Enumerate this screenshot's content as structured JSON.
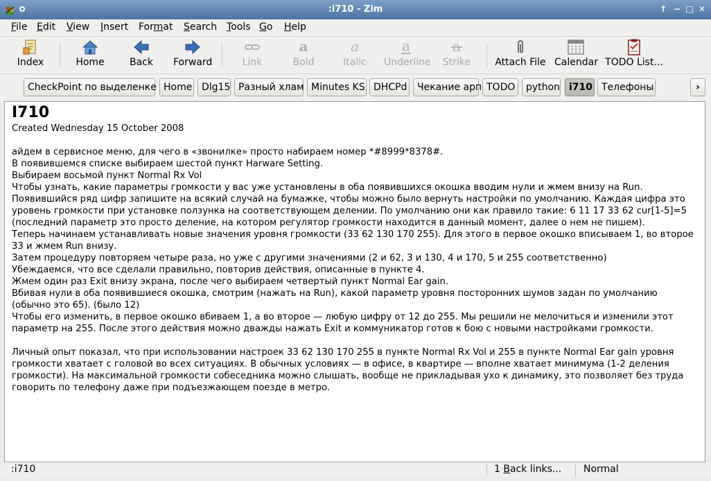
{
  "window": {
    "title": ":i710 - Zim",
    "controls": {
      "up": "↑",
      "minimize": "−",
      "maximize": "□",
      "close": "✕"
    }
  },
  "menubar": {
    "items": [
      {
        "name": "file",
        "before": "",
        "mnemonic": "F",
        "after": "ile"
      },
      {
        "name": "edit",
        "before": "",
        "mnemonic": "E",
        "after": "dit"
      },
      {
        "name": "view",
        "before": "",
        "mnemonic": "V",
        "after": "iew"
      },
      {
        "name": "insert",
        "before": "",
        "mnemonic": "I",
        "after": "nsert"
      },
      {
        "name": "format",
        "before": "For",
        "mnemonic": "m",
        "after": "at"
      },
      {
        "name": "search",
        "before": "",
        "mnemonic": "S",
        "after": "earch"
      },
      {
        "name": "tools",
        "before": "",
        "mnemonic": "T",
        "after": "ools"
      },
      {
        "name": "go",
        "before": "",
        "mnemonic": "G",
        "after": "o"
      },
      {
        "name": "help",
        "before": "",
        "mnemonic": "H",
        "after": "elp"
      }
    ]
  },
  "toolbar": {
    "index": "Index",
    "home": "Home",
    "back": "Back",
    "forward": "Forward",
    "link": "Link",
    "bold": "Bold",
    "italic": "Italic",
    "underline": "Underline",
    "strike": "Strike",
    "attach": "Attach File",
    "calendar": "Calendar",
    "todo": "TODO List..."
  },
  "pathbar": {
    "items": [
      "CheckPoint по выделенке",
      "Home",
      "Dlg15",
      "Разный хлам",
      "Minutes KS",
      "DHCPd",
      "Чекание арп",
      "TODO",
      "python",
      "i710",
      "Телефоны"
    ],
    "active": "i710",
    "scroll_arrow": "›"
  },
  "page": {
    "heading": "I710",
    "created": "Created Wednesday 15 October 2008",
    "lines": [
      "айдем в сервисное меню, для чего в «звонилке» просто набираем номер *#8999*8378#.",
      "В появившемся списке выбираем шестой пункт Harware Setting.",
      "Выбираем восьмой пункт Normal Rx Vol",
      "Чтобы узнать, какие параметры громкости у вас уже установлены в оба появившихся окошка вводим нули и жмем внизу на Run.",
      "Появившийся ряд цифр запишите на всякий случай на бумажке, чтобы можно было вернуть настройки по умолчанию. Каждая цифра это уровень громкости при установке ползунка на соответствующем делении. По умолчанию они как правило такие: 6 11 17 33 62 cur[1-5]=5 (последний параметр это просто деление, на котором регулятор громкости находится в данный момент, далее о нем не пишем).",
      "Теперь начинаем устанавливать новые значения уровня громкости (33 62 130 170 255). Для этого в первое окошко вписываем 1, во второе 33 и жмем Run внизу.",
      "Затем процедуру повторяем четыре раза, но уже с другими значениями (2 и 62, 3 и 130, 4 и 170, 5 и 255 соответственно)",
      "Убеждаемся, что все сделали правильно, повторив действия, описанные в пункте 4.",
      "Жмем один раз Exit внизу экрана, после чего выбираем четвертый пункт Normal Ear gain.",
      "Вбивая нули в оба появившиеся окошка, смотрим (нажать на Run), какой параметр уровня посторонних шумов задан по умолчанию (обычно это 65). (было 12)",
      "Чтобы его изменить, в первое окошко вбиваем 1, а во второе — любую цифру от 12 до 255. Мы решили не мелочиться и изменили этот параметр на 255. После этого действия можно дважды нажать Exit и коммуникатор готов к бою с новыми настройками громкости.",
      "",
      "Личный опыт показал, что при использовании настроек 33 62 130 170 255 в пункте Normal Rx Vol и 255 в пункте Normal Ear gain уровня громкости хватает с головой во всех ситуациях. В обычных условиях — в офисе, в квартире — вполне хватает минимума (1-2 деления громкости). На максимальной громкости собеседника можно слышать, вообще не прикладывая ухо к динамику, это позволяет без труда говорить по телефону даже при подъезжающем поезде в метро."
    ]
  },
  "statusbar": {
    "page": ":i710",
    "backlinks_before": "1 ",
    "backlinks_mnemonic": "B",
    "backlinks_after": "ack links...",
    "style": "Normal"
  }
}
